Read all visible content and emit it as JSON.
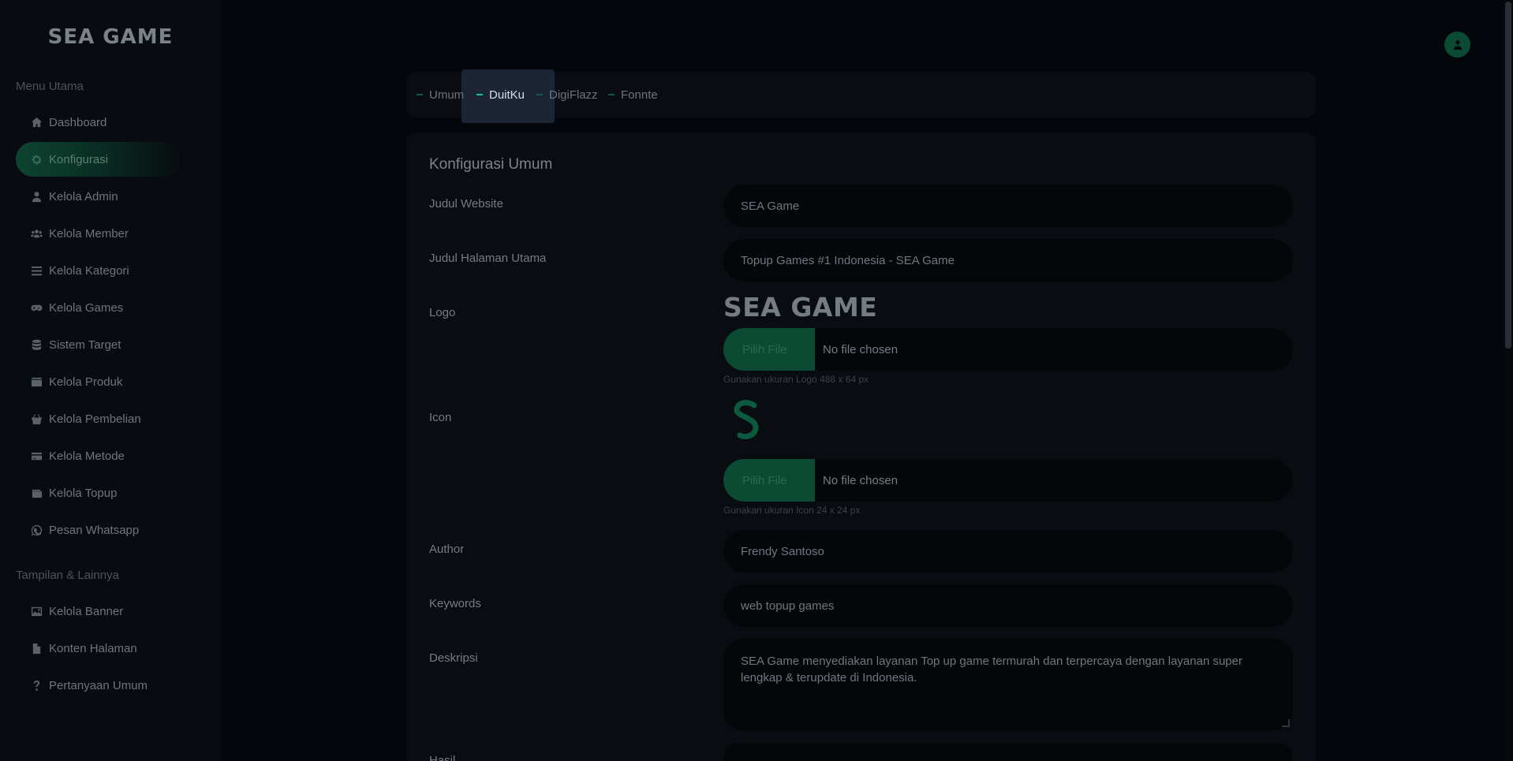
{
  "brand": {
    "name": "SEA GAME"
  },
  "sidebar": {
    "section_main": "Menu Utama",
    "section_other": "Tampilan & Lainnya",
    "items": [
      {
        "label": "Dashboard",
        "icon": "home-icon"
      },
      {
        "label": "Konfigurasi",
        "icon": "gear-icon"
      },
      {
        "label": "Kelola Admin",
        "icon": "user-icon"
      },
      {
        "label": "Kelola Member",
        "icon": "users-icon"
      },
      {
        "label": "Kelola Kategori",
        "icon": "list-icon"
      },
      {
        "label": "Kelola Games",
        "icon": "gamepad-icon"
      },
      {
        "label": "Sistem Target",
        "icon": "database-icon"
      },
      {
        "label": "Kelola Produk",
        "icon": "box-icon"
      },
      {
        "label": "Kelola Pembelian",
        "icon": "basket-icon"
      },
      {
        "label": "Kelola Metode",
        "icon": "credit-card-icon"
      },
      {
        "label": "Kelola Topup",
        "icon": "wallet-icon"
      },
      {
        "label": "Pesan Whatsapp",
        "icon": "whatsapp-icon"
      }
    ],
    "other_items": [
      {
        "label": "Kelola Banner",
        "icon": "image-icon"
      },
      {
        "label": "Konten Halaman",
        "icon": "file-icon"
      },
      {
        "label": "Pertanyaan Umum",
        "icon": "question-icon"
      }
    ],
    "active_item": "Konfigurasi"
  },
  "tabs": [
    {
      "label": "Umum"
    },
    {
      "label": "DuitKu"
    },
    {
      "label": "DigiFlazz"
    },
    {
      "label": "Fonnte"
    }
  ],
  "active_tab": "DuitKu",
  "form": {
    "title": "Konfigurasi Umum",
    "judul_website": {
      "label": "Judul Website",
      "value": "SEA Game"
    },
    "judul_halaman": {
      "label": "Judul Halaman Utama",
      "value": "Topup Games #1 Indonesia - SEA Game"
    },
    "logo": {
      "label": "Logo",
      "preview_text": "SEA GAME",
      "button": "Pilih File",
      "file_status": "No file chosen",
      "hint": "Gunakan ukuran Logo 488 x 64 px"
    },
    "icon": {
      "label": "Icon",
      "button": "Pilih File",
      "file_status": "No file chosen",
      "hint": "Gunakan ukuran Icon 24 x 24 px"
    },
    "author": {
      "label": "Author",
      "value": "Frendy Santoso"
    },
    "keywords": {
      "label": "Keywords",
      "value": "web topup games"
    },
    "deskripsi": {
      "label": "Deskripsi",
      "value": "SEA Game menyediakan layanan Top up game  termurah dan terpercaya  dengan layanan super lengkap & terupdate di Indonesia."
    },
    "next_field": {
      "label": "Hasil"
    }
  },
  "colors": {
    "accent": "#17c78a",
    "accent_dark": "#0b4a33",
    "bg": "#03060a",
    "panel": "#090d12"
  }
}
